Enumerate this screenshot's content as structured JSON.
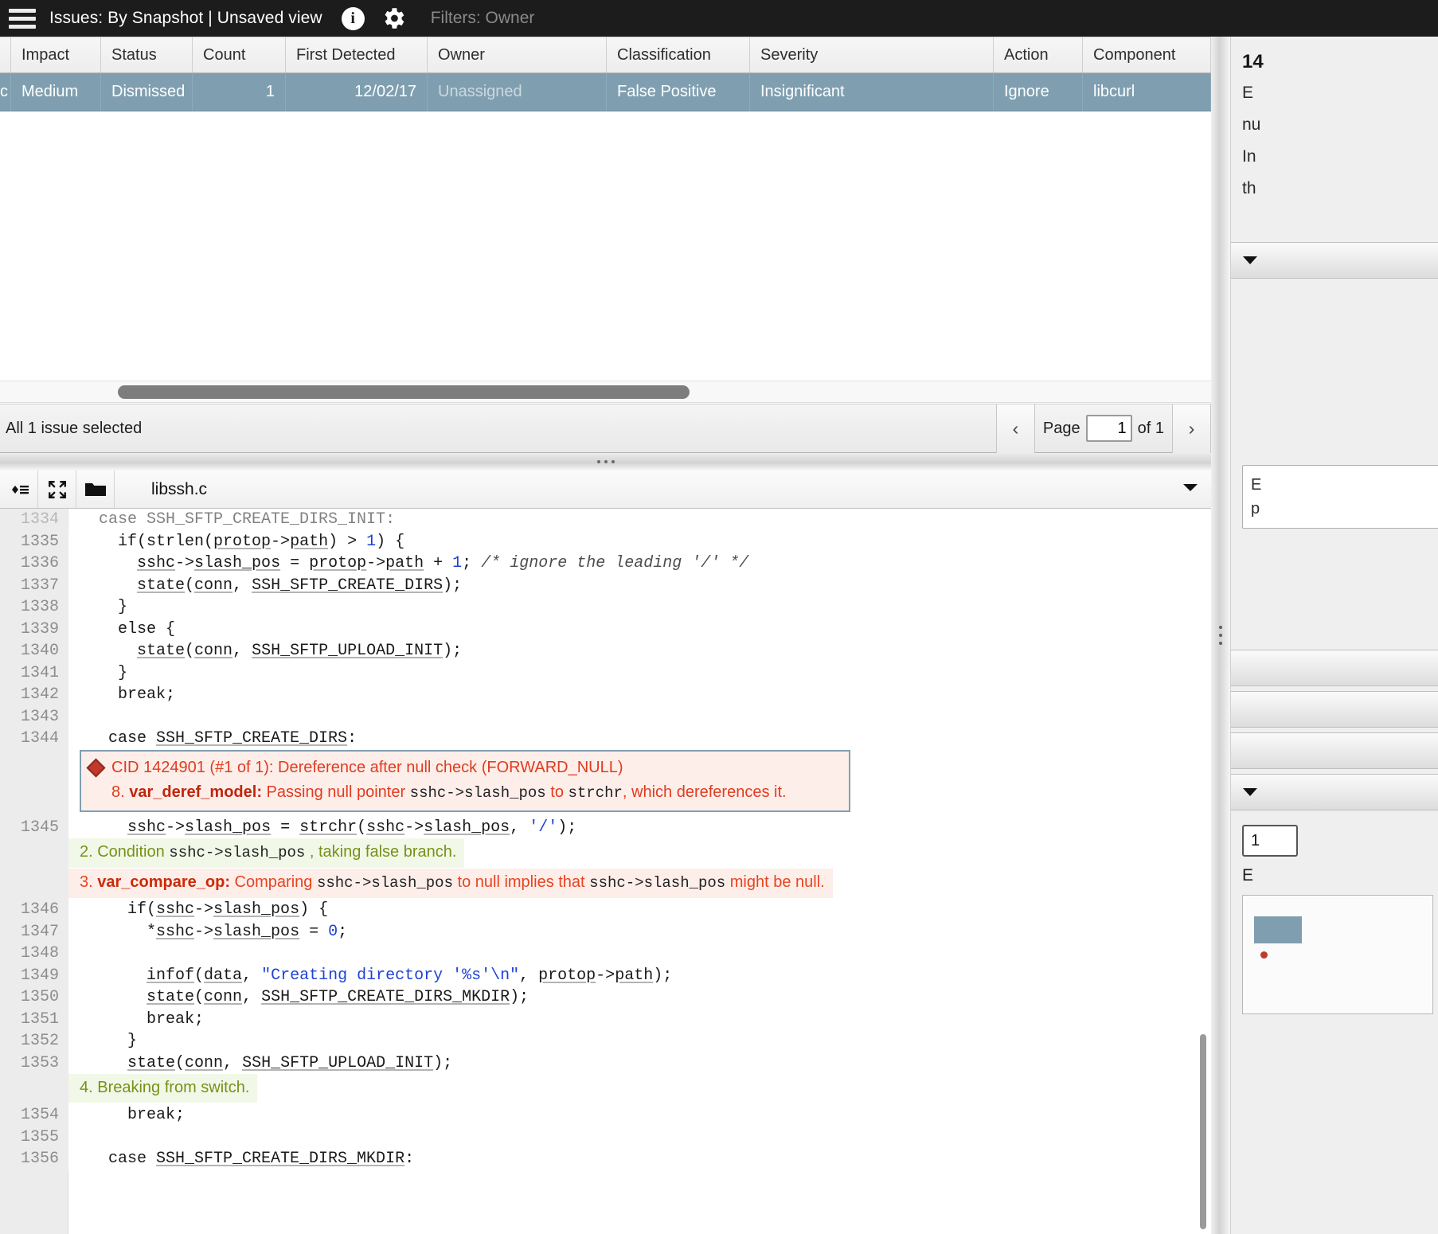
{
  "topbar": {
    "menu_icon": "hamburger-menu-icon",
    "title": "Issues: By Snapshot | Unsaved view",
    "info_icon": "i",
    "info_icon_name": "info-icon",
    "gear_icon_name": "gear-icon",
    "filters_label": "Filters: Owner"
  },
  "table": {
    "columns": [
      {
        "key": "truncated",
        "label": ""
      },
      {
        "key": "impact",
        "label": "Impact"
      },
      {
        "key": "status",
        "label": "Status"
      },
      {
        "key": "count",
        "label": "Count"
      },
      {
        "key": "first_detected",
        "label": "First Detected"
      },
      {
        "key": "owner",
        "label": "Owner"
      },
      {
        "key": "classification",
        "label": "Classification"
      },
      {
        "key": "severity",
        "label": "Severity"
      },
      {
        "key": "action",
        "label": "Action"
      },
      {
        "key": "component",
        "label": "Component"
      }
    ],
    "rows": [
      {
        "truncated": "c",
        "impact": "Medium",
        "status": "Dismissed",
        "count": "1",
        "first_detected": "12/02/17",
        "owner": "Unassigned",
        "classification": "False Positive",
        "severity": "Insignificant",
        "action": "Ignore",
        "component": "libcurl"
      }
    ]
  },
  "pager": {
    "selection_text": "All 1 issue selected",
    "prev_label": "‹",
    "next_label": "›",
    "page_word": "Page",
    "page_value": "1",
    "of_text": "of 1"
  },
  "filebar": {
    "occurrence_icon_name": "occurrence-list-icon",
    "expand_icon_name": "expand-icon",
    "folder_icon_name": "folder-icon",
    "filename": "libssh.c",
    "caret_icon_name": "chevron-down-icon"
  },
  "code": {
    "lines": [
      {
        "type": "code",
        "num": "1334",
        "clipped": true,
        "html": "  case SSH_SFTP_CREATE_DIRS_INIT:"
      },
      {
        "type": "code",
        "num": "1335",
        "html": "    if(strlen(<u class=\"ident\">protop</u>-><u class=\"ident\">path</u>) > <span class=\"num-lit\">1</span>) {"
      },
      {
        "type": "code",
        "num": "1336",
        "html": "      <u class=\"ident\">sshc</u>-><u class=\"ident\">slash_pos</u> = <u class=\"ident\">protop</u>-><u class=\"ident\">path</u> + <span class=\"num-lit\">1</span>; <span class=\"cmt\">/* ignore the leading '/' */</span>"
      },
      {
        "type": "code",
        "num": "1337",
        "html": "      <u class=\"ident\">state</u>(<u class=\"ident\">conn</u>, <u class=\"ident\">SSH_SFTP_CREATE_DIRS</u>);"
      },
      {
        "type": "code",
        "num": "1338",
        "html": "    }"
      },
      {
        "type": "code",
        "num": "1339",
        "html": "    else {"
      },
      {
        "type": "code",
        "num": "1340",
        "html": "      <u class=\"ident\">state</u>(<u class=\"ident\">conn</u>, <u class=\"ident\">SSH_SFTP_UPLOAD_INIT</u>);"
      },
      {
        "type": "code",
        "num": "1341",
        "html": "    }"
      },
      {
        "type": "code",
        "num": "1342",
        "html": "    break;"
      },
      {
        "type": "code",
        "num": "1343",
        "html": ""
      },
      {
        "type": "code",
        "num": "1344",
        "html": "   case <u class=\"ident\">SSH_SFTP_CREATE_DIRS</u>:"
      },
      {
        "type": "defect",
        "num": ""
      },
      {
        "type": "code",
        "num": "1345",
        "html": "     <u class=\"ident\">sshc</u>-><u class=\"ident\">slash_pos</u> = <u class=\"ident\">strchr</u>(<u class=\"ident\">sshc</u>-><u class=\"ident\">slash_pos</u>, <span class=\"str-lit\">'/'</span>);"
      },
      {
        "type": "event",
        "num": "",
        "tone": "green",
        "html": "2. Condition <span class=\"mono-in\">sshc-&gt;slash_pos</span> , taking false branch."
      },
      {
        "type": "event",
        "num": "",
        "tone": "red",
        "html": "3. <b>var_compare_op:</b> Comparing <span class=\"mono-in\">sshc-&gt;slash_pos</span> to null implies that <span class=\"mono-in\">sshc-&gt;slash_pos</span> might be null."
      },
      {
        "type": "code",
        "num": "1346",
        "html": "     if(<u class=\"ident\">sshc</u>-><u class=\"ident\">slash_pos</u>) {"
      },
      {
        "type": "code",
        "num": "1347",
        "html": "       *<u class=\"ident\">sshc</u>-><u class=\"ident\">slash_pos</u> = <span class=\"num-lit\">0</span>;"
      },
      {
        "type": "code",
        "num": "1348",
        "html": ""
      },
      {
        "type": "code",
        "num": "1349",
        "html": "       <u class=\"ident\">infof</u>(<u class=\"ident\">data</u>, <span class=\"str-lit\">\"Creating directory '%s'\\n\"</span>, <u class=\"ident\">protop</u>-><u class=\"ident\">path</u>);"
      },
      {
        "type": "code",
        "num": "1350",
        "html": "       <u class=\"ident\">state</u>(<u class=\"ident\">conn</u>, <u class=\"ident\">SSH_SFTP_CREATE_DIRS_MKDIR</u>);"
      },
      {
        "type": "code",
        "num": "1351",
        "html": "       break;"
      },
      {
        "type": "code",
        "num": "1352",
        "html": "     }"
      },
      {
        "type": "code",
        "num": "1353",
        "html": "     <u class=\"ident\">state</u>(<u class=\"ident\">conn</u>, <u class=\"ident\">SSH_SFTP_UPLOAD_INIT</u>);"
      },
      {
        "type": "event",
        "num": "",
        "tone": "green",
        "html": "4. Breaking from switch."
      },
      {
        "type": "code",
        "num": "1354",
        "html": "     break;"
      },
      {
        "type": "code",
        "num": "1355",
        "html": ""
      },
      {
        "type": "code",
        "num": "1356",
        "html": "   case <u class=\"ident\">SSH_SFTP_CREATE_DIRS_MKDIR</u>:"
      }
    ],
    "defect": {
      "icon_name": "defect-diamond-icon",
      "title": "CID 1424901 (#1 of 1): Dereference after null check (FORWARD_NULL)",
      "event_number": "8.",
      "event_tag": "var_deref_model:",
      "event_text_a": "Passing null pointer",
      "event_var_a": "sshc->slash_pos",
      "event_text_b": "to",
      "event_var_b": "strchr",
      "event_text_c": ", which dereferences it."
    }
  },
  "right_panel": {
    "title": "14",
    "body_line_1": "E",
    "body_line_2": "nu",
    "body_line_3": "In",
    "body_line_4": "th",
    "bar_1": "",
    "bar_2": "",
    "bar_3": "",
    "bar_4": "",
    "bar_5": "",
    "box_line_1": "E",
    "box_line_2": "p",
    "field_value": "1",
    "label_text": "E",
    "caret_icon_name": "chevron-down-icon"
  },
  "colors": {
    "topbar_bg": "#1c1c1c",
    "row_selected_bg": "#7f9fb0",
    "defect_red": "#e03c1e",
    "event_green": "#7b8f18",
    "event_green_bg": "#f2f8e8",
    "event_red_bg": "#fdeeea",
    "code_keyword_blue": "#1e42d6"
  }
}
